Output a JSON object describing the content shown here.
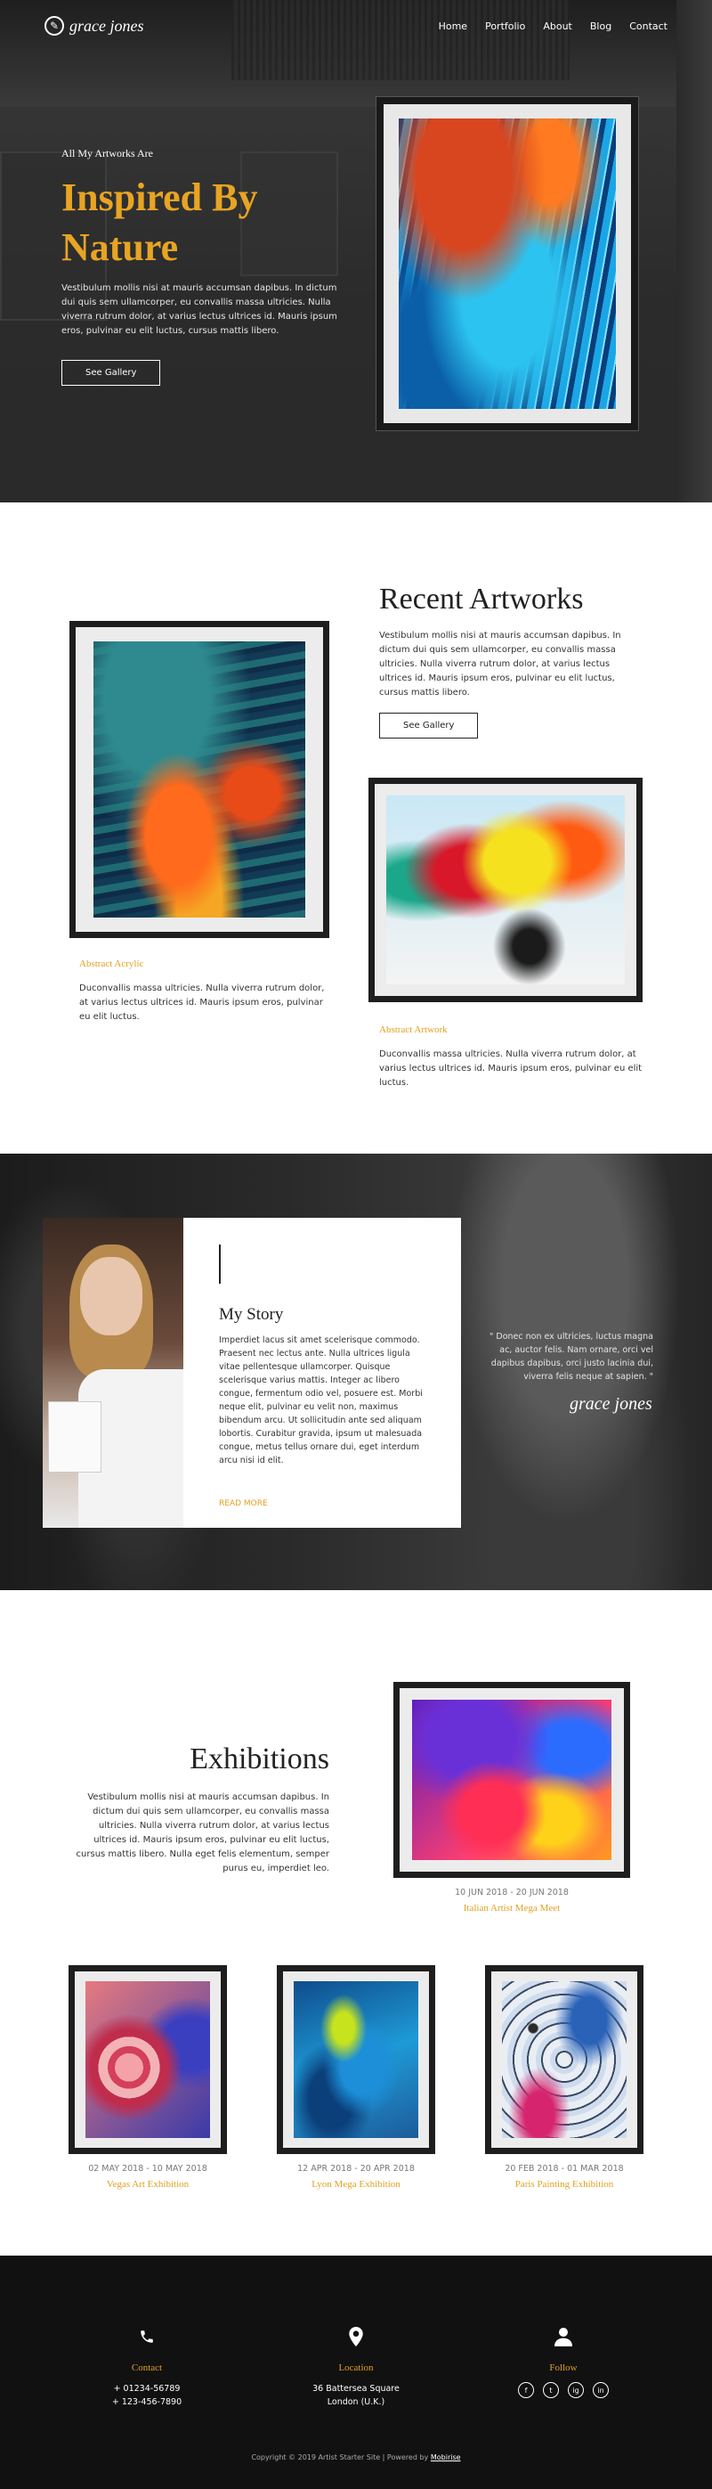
{
  "header": {
    "logo_text": "grace jones",
    "menu": [
      "Home",
      "Portfolio",
      "About",
      "Blog",
      "Contact"
    ]
  },
  "hero": {
    "eyebrow": "All My Artworks Are",
    "title_line1": "Inspired By",
    "title_line2": "Nature",
    "text": "Vestibulum mollis nisi at mauris accumsan dapibus. In dictum dui quis sem ullamcorper, eu convallis massa ultricies. Nulla viverra rutrum dolor, at varius lectus ultrices id. Mauris ipsum eros, pulvinar eu elit luctus, cursus mattis libero.",
    "button": "See Gallery"
  },
  "recent": {
    "title": "Recent Artworks",
    "text": "Vestibulum mollis nisi at mauris accumsan dapibus. In dictum dui quis sem ullamcorper, eu convallis massa ultricies. Nulla viverra rutrum dolor, at varius lectus ultrices id. Mauris ipsum eros, pulvinar eu elit luctus, cursus mattis libero.",
    "button": "See Gallery",
    "items": [
      {
        "title": "Abstract Acrylic",
        "text": "Duconvallis massa ultricies. Nulla viverra rutrum dolor, at varius lectus ultrices id. Mauris ipsum eros, pulvinar eu elit luctus."
      },
      {
        "title": "Abstract Artwork",
        "text": "Duconvallis massa ultricies. Nulla viverra rutrum dolor, at varius lectus ultrices id. Mauris ipsum eros, pulvinar eu elit luctus."
      }
    ]
  },
  "story": {
    "title": "My Story",
    "text": "Imperdiet lacus sit amet scelerisque commodo. Praesent nec lectus ante. Nulla ultrices ligula vitae pellentesque ullamcorper. Quisque scelerisque varius mattis. Integer ac libero congue, fermentum odio vel, posuere est. Morbi neque elit, pulvinar eu velit non, maximus bibendum arcu. Ut sollicitudin ante sed aliquam lobortis. Curabitur gravida, ipsum ut malesuada congue, metus tellus ornare dui, eget interdum arcu nisi id elit.",
    "more": "READ MORE",
    "quote": "\" Donec non ex ultricies, luctus magna ac, auctor felis. Nam ornare, orci vel dapibus dapibus, orci justo lacinia dui, viverra felis neque at sapien. \"",
    "signature": "grace jones"
  },
  "exhibitions": {
    "title": "Exhibitions",
    "text": "Vestibulum mollis nisi at mauris accumsan dapibus. In dictum dui quis sem ullamcorper, eu convallis massa ultricies. Nulla viverra rutrum dolor, at varius lectus ultrices id. Mauris ipsum eros, pulvinar eu elit luctus, cursus mattis libero. Nulla eget felis elementum, semper purus eu, imperdiet leo.",
    "items": [
      {
        "dates": "10 JUN 2018 - 20 JUN 2018",
        "name": "Italian Artist Mega Meet"
      },
      {
        "dates": "02 MAY 2018 - 10 MAY 2018",
        "name": "Vegas Art Exhibition"
      },
      {
        "dates": "12 APR 2018 - 20 APR 2018",
        "name": "Lyon Mega Exhibition"
      },
      {
        "dates": "20 FEB 2018 - 01 MAR 2018",
        "name": "Paris Painting Exhibition"
      }
    ]
  },
  "footer": {
    "contact": {
      "title": "Contact",
      "line1": "+ 01234-56789",
      "line2": "+ 123-456-7890"
    },
    "location": {
      "title": "Location",
      "line1": "36 Battersea Square",
      "line2": "London (U.K.)"
    },
    "follow": {
      "title": "Follow",
      "icons": [
        "f",
        "t",
        "ig",
        "in"
      ]
    },
    "copyright": "Copyright © 2019 Artist Starter Site | Powered by",
    "powered": "Mobirise"
  }
}
